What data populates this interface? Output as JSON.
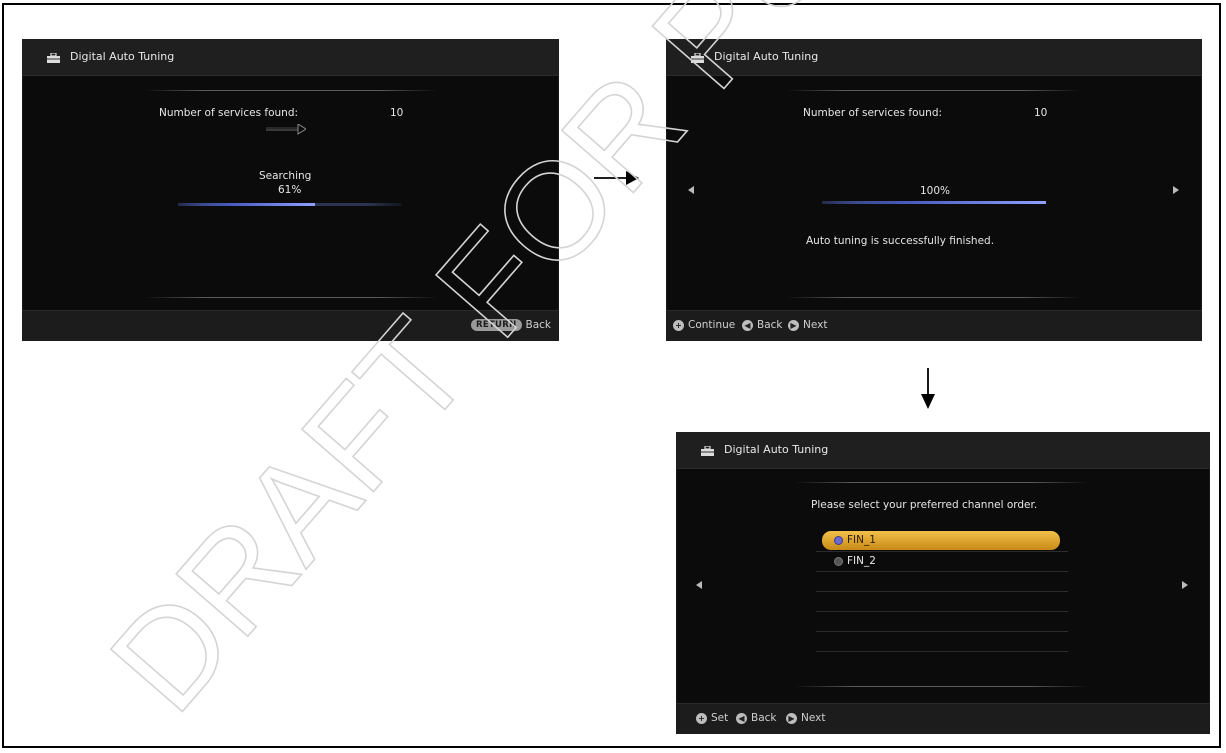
{
  "watermark": "DRAFT FOR PUBLIC CONSULTATION",
  "screen1": {
    "title": "Digital Auto Tuning",
    "services_label": "Number of services found:",
    "services_count": "10",
    "status": "Searching",
    "percent": "61%",
    "progress": 0.61,
    "return_key": "RETURN",
    "back_label": "Back"
  },
  "screen2": {
    "title": "Digital Auto Tuning",
    "services_label": "Number of services found:",
    "services_count": "10",
    "percent": "100%",
    "progress": 1.0,
    "message": "Auto tuning is successfully finished.",
    "hints": [
      "Continue",
      "Back",
      "Next"
    ]
  },
  "screen3": {
    "title": "Digital Auto Tuning",
    "prompt": "Please select your preferred channel order.",
    "options": [
      "FIN_1",
      "FIN_2"
    ],
    "selected_index": 0,
    "hints": [
      "Set",
      "Back",
      "Next"
    ]
  },
  "colors": {
    "selection": "#e0a82e",
    "progress": "#6c7fe8",
    "screen_bg": "#0b0b0b"
  }
}
